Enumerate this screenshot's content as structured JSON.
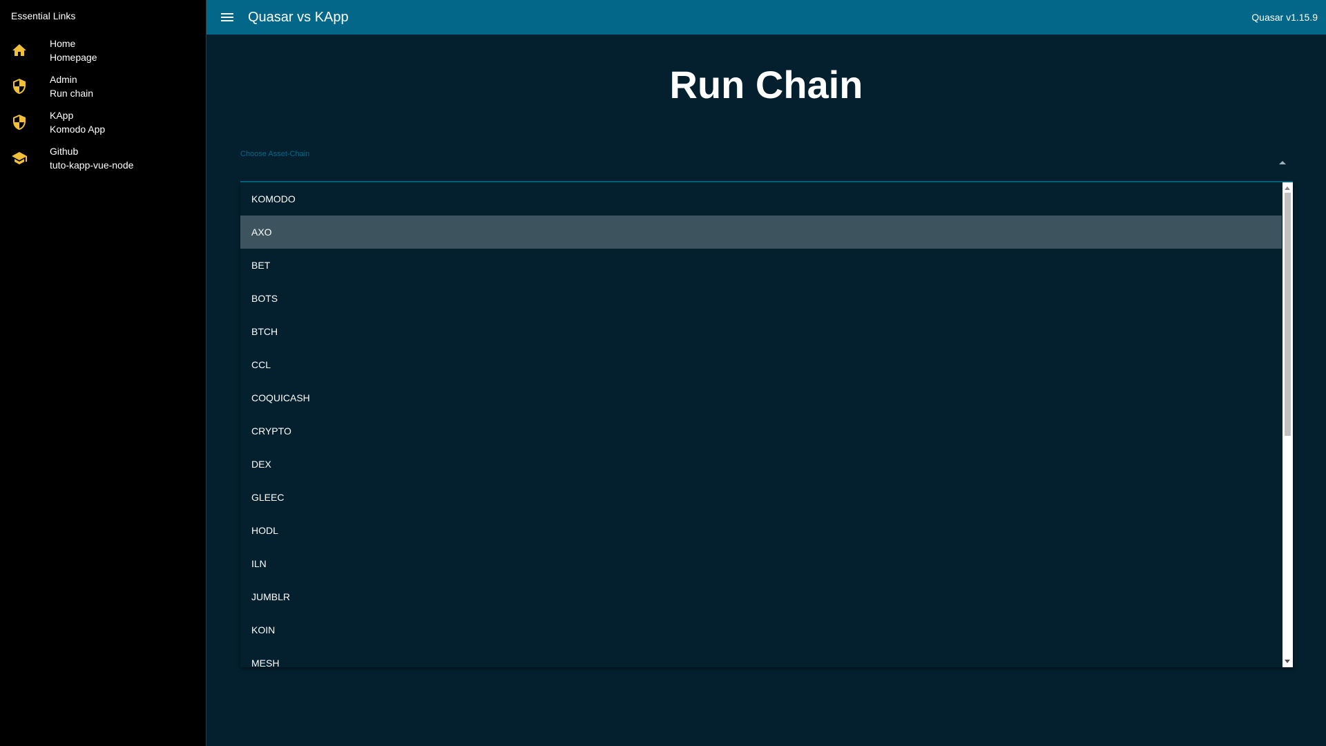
{
  "sidebar": {
    "header": "Essential Links",
    "items": [
      {
        "title": "Home",
        "caption": "Homepage",
        "icon": "home-icon"
      },
      {
        "title": "Admin",
        "caption": "Run chain",
        "icon": "shield-icon"
      },
      {
        "title": "KApp",
        "caption": "Komodo App",
        "icon": "shield-icon"
      },
      {
        "title": "Github",
        "caption": "tuto-kapp-vue-node",
        "icon": "school-icon"
      }
    ]
  },
  "header": {
    "title": "Quasar vs KApp",
    "version": "Quasar v1.15.9"
  },
  "main": {
    "title": "Run Chain",
    "select": {
      "label": "Choose Asset-Chain",
      "value": ""
    },
    "options": [
      "KOMODO",
      "AXO",
      "BET",
      "BOTS",
      "BTCH",
      "CCL",
      "COQUICASH",
      "CRYPTO",
      "DEX",
      "GLEEC",
      "HODL",
      "ILN",
      "JUMBLR",
      "KOIN",
      "MESH"
    ],
    "highlighted_option": "AXO"
  },
  "colors": {
    "primary": "#026788",
    "accent": "#f2c037",
    "background": "#04202f",
    "sidebar": "#000000"
  }
}
